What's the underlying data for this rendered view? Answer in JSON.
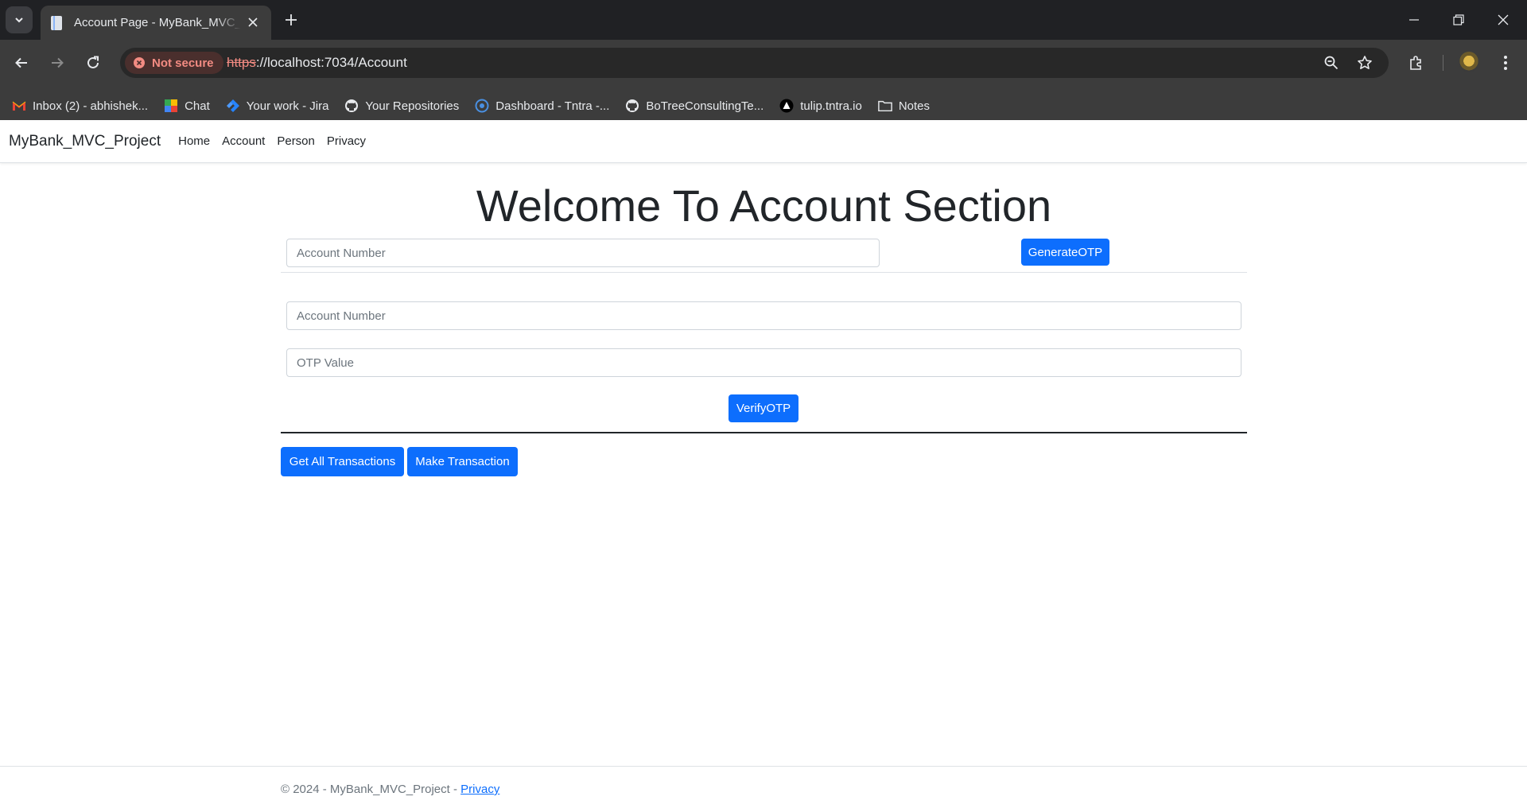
{
  "browser": {
    "tab_title": "Account Page - MyBank_MVC_Project",
    "security_label": "Not secure",
    "url_scheme": "https",
    "url_rest": "://localhost:7034/Account",
    "bookmarks": [
      {
        "label": "Inbox (2) - abhishek...",
        "icon": "gmail-icon"
      },
      {
        "label": "Chat",
        "icon": "chat-icon"
      },
      {
        "label": "Your work - Jira",
        "icon": "jira-icon"
      },
      {
        "label": "Your Repositories",
        "icon": "github-icon"
      },
      {
        "label": "Dashboard - Tntra -...",
        "icon": "dashboard-icon"
      },
      {
        "label": "BoTreeConsultingTe...",
        "icon": "github-icon"
      },
      {
        "label": "tulip.tntra.io",
        "icon": "tulip-icon"
      },
      {
        "label": "Notes",
        "icon": "folder-icon"
      }
    ]
  },
  "navbar": {
    "brand": "MyBank_MVC_Project",
    "links": [
      "Home",
      "Account",
      "Person",
      "Privacy"
    ]
  },
  "main": {
    "heading": "Welcome To Account Section",
    "generate": {
      "account_placeholder": "Account Number",
      "button": "GenerateOTP"
    },
    "verify": {
      "account_placeholder": "Account Number",
      "otp_placeholder": "OTP Value",
      "button": "VerifyOTP"
    },
    "actions": {
      "get_all": "Get All Transactions",
      "make": "Make Transaction"
    }
  },
  "footer": {
    "text": "© 2024 - MyBank_MVC_Project - ",
    "link": "Privacy"
  },
  "colors": {
    "primary": "#0d6efd",
    "chrome_dark": "#202124",
    "chrome_toolbar": "#3c3c3c"
  }
}
